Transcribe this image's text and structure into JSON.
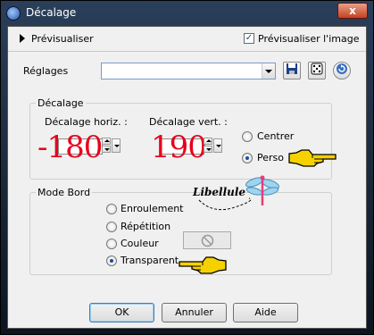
{
  "window": {
    "title": "Décalage",
    "close_label": "x"
  },
  "preview": {
    "label": "Prévisualiser",
    "check_label": "Prévisualiser l'image",
    "checked": true
  },
  "presets": {
    "label": "Réglages",
    "value": ""
  },
  "offset": {
    "group_label": "Décalage",
    "horiz_label": "Décalage horiz. :",
    "vert_label": "Décalage vert. :",
    "horiz_value": "-180",
    "vert_value": "190",
    "options": [
      {
        "label": "Centrer",
        "selected": false
      },
      {
        "label": "Perso",
        "selected": true
      }
    ]
  },
  "edge_mode": {
    "group_label": "Mode Bord",
    "options": [
      {
        "label": "Enroulement",
        "selected": false
      },
      {
        "label": "Répétition",
        "selected": false
      },
      {
        "label": "Couleur",
        "selected": false
      },
      {
        "label": "Transparent",
        "selected": true
      }
    ]
  },
  "watermark": {
    "text": "Libellule"
  },
  "buttons": {
    "ok": "OK",
    "cancel": "Annuler",
    "help": "Aide"
  },
  "colors": {
    "offset_number": "#e8001c",
    "hand_fill": "#f6d100"
  },
  "icons": [
    "save-icon",
    "dice-icon",
    "reset-icon",
    "no-color-icon",
    "pointing-hand-icon"
  ]
}
